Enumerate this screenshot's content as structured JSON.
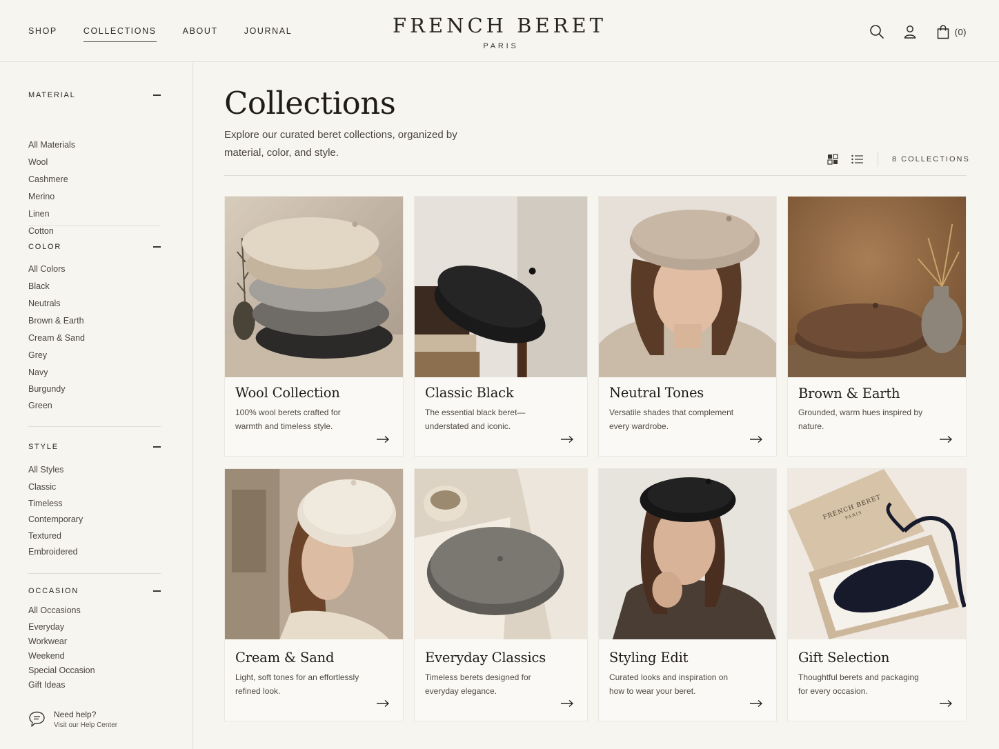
{
  "header": {
    "nav": [
      {
        "label": "SHOP",
        "active": false
      },
      {
        "label": "COLLECTIONS",
        "active": true
      },
      {
        "label": "ABOUT",
        "active": false
      },
      {
        "label": "JOURNAL",
        "active": false
      }
    ],
    "brand": "FRENCH BERET",
    "brand_sub": "PARIS",
    "cart_count": "(0)",
    "icons": [
      "search-icon",
      "account-icon",
      "bag-icon"
    ]
  },
  "sidebar": {
    "groups": [
      {
        "title": "MATERIAL",
        "items": [
          "All Materials",
          "Wool",
          "Cashmere",
          "Merino",
          "Linen",
          "Cotton"
        ]
      },
      {
        "title": "COLOR",
        "items": [
          "All Colors",
          "Black",
          "Neutrals",
          "Brown & Earth",
          "Cream & Sand",
          "Grey",
          "Navy",
          "Burgundy",
          "Green"
        ]
      },
      {
        "title": "STYLE",
        "items": [
          "All Styles",
          "Classic",
          "Timeless",
          "Contemporary",
          "Textured",
          "Embroidered"
        ]
      },
      {
        "title": "OCCASION",
        "items": [
          "All Occasions",
          "Everyday",
          "Workwear",
          "Weekend",
          "Special Occasion",
          "Gift Ideas"
        ]
      }
    ],
    "help_title": "Need help?",
    "help_link": "Visit our Help Center"
  },
  "main": {
    "title": "Collections",
    "subtitle": "Explore our curated beret collections, organized by material, color, and style.",
    "count_label": "8 COLLECTIONS",
    "view_icons": [
      "grid-view-icon",
      "list-view-icon"
    ]
  },
  "collections": [
    {
      "title": "Wool Collection",
      "desc": "100% wool berets crafted for warmth and timeless style."
    },
    {
      "title": "Classic Black",
      "desc": "The essential black beret—understated and iconic."
    },
    {
      "title": "Neutral Tones",
      "desc": "Versatile shades that complement every wardrobe."
    },
    {
      "title": "Brown & Earth",
      "desc": "Grounded, warm hues inspired by nature."
    },
    {
      "title": "Cream & Sand",
      "desc": "Light, soft tones for an effortlessly refined look."
    },
    {
      "title": "Everyday Classics",
      "desc": "Timeless berets designed for everyday elegance."
    },
    {
      "title": "Styling Edit",
      "desc": "Curated looks and inspiration on how to wear your beret."
    },
    {
      "title": "Gift Selection",
      "desc": "Thoughtful berets and packaging for every occasion."
    }
  ],
  "gift_box_print": {
    "line1": "FRENCH BERET",
    "line2": "PARIS"
  },
  "colors": {
    "background": "#f7f5f0",
    "card": "#faf9f6",
    "text": "#2a2622",
    "border": "#e3ded5"
  }
}
